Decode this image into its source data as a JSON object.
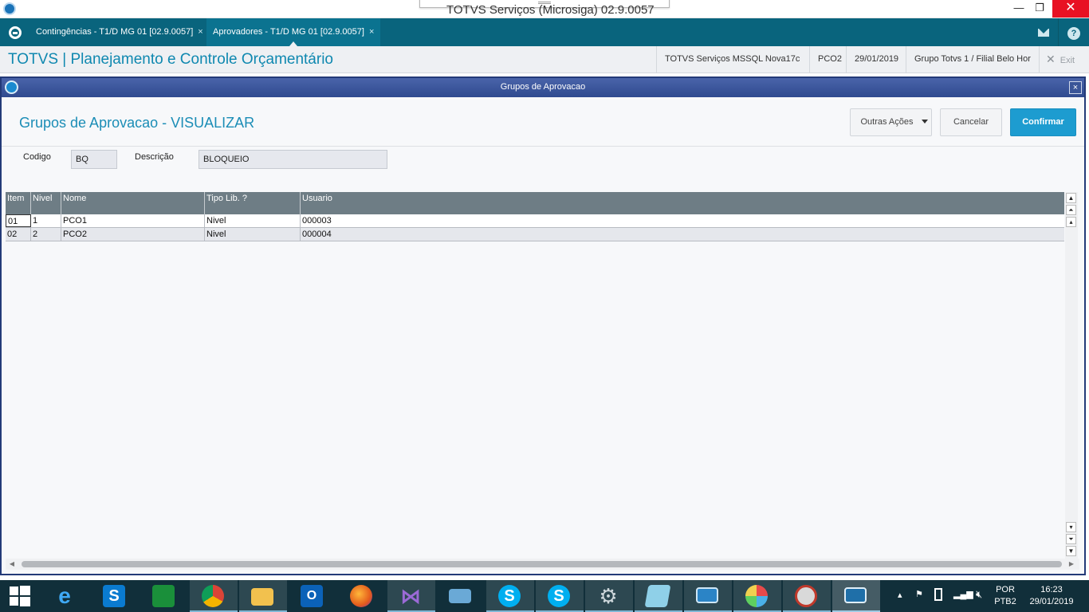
{
  "window": {
    "title": "TOTVS Serviços (Microsiga) 02.9.0057",
    "minimize": "—",
    "restore": "❐",
    "close": "✕"
  },
  "tabs": [
    {
      "label": "Contingências - T1/D MG 01  [02.9.0057]",
      "close": "×"
    },
    {
      "label": "Aprovadores - T1/D MG 01  [02.9.0057]",
      "close": "×"
    }
  ],
  "header": {
    "app_title": "TOTVS | Planejamento e Controle Orçamentário",
    "server": "TOTVS Serviços MSSQL Nova17c",
    "env": "PCO2",
    "date": "29/01/2019",
    "company": "Grupo Totvs 1 / Filial Belo Hor",
    "exit_icon": "✕",
    "exit_label": "Exit"
  },
  "dialog": {
    "title": "Grupos de Aprovacao",
    "close": "×",
    "heading": "Grupos de Aprovacao - VISUALIZAR",
    "buttons": {
      "other_actions": "Outras Ações",
      "cancel": "Cancelar",
      "confirm": "Confirmar"
    },
    "fields": {
      "codigo_label": "Codigo",
      "codigo_value": "BQ",
      "descricao_label": "Descrição",
      "descricao_value": "BLOQUEIO"
    },
    "grid": {
      "columns": [
        "Item",
        "Nivel",
        "Nome",
        "Tipo Lib.  ?",
        "Usuario"
      ],
      "rows": [
        [
          "01",
          "1",
          "PCO1",
          "Nivel",
          "000003"
        ],
        [
          "02",
          "2",
          "PCO2",
          "Nivel",
          "000004"
        ]
      ]
    }
  },
  "taskbar": {
    "apps": [
      "start-windows",
      "internet-explorer",
      "skype-business",
      "store",
      "chrome",
      "file-explorer",
      "outlook",
      "firefox",
      "visual-studio",
      "remote-app",
      "skype-alert",
      "skype",
      "settings-gears",
      "notepad",
      "remote-desktop",
      "paint",
      "tools",
      "totvs-smartclient"
    ],
    "lang_top": "POR",
    "lang_bottom": "PTB2",
    "time": "16:23",
    "date": "29/01/2019"
  }
}
